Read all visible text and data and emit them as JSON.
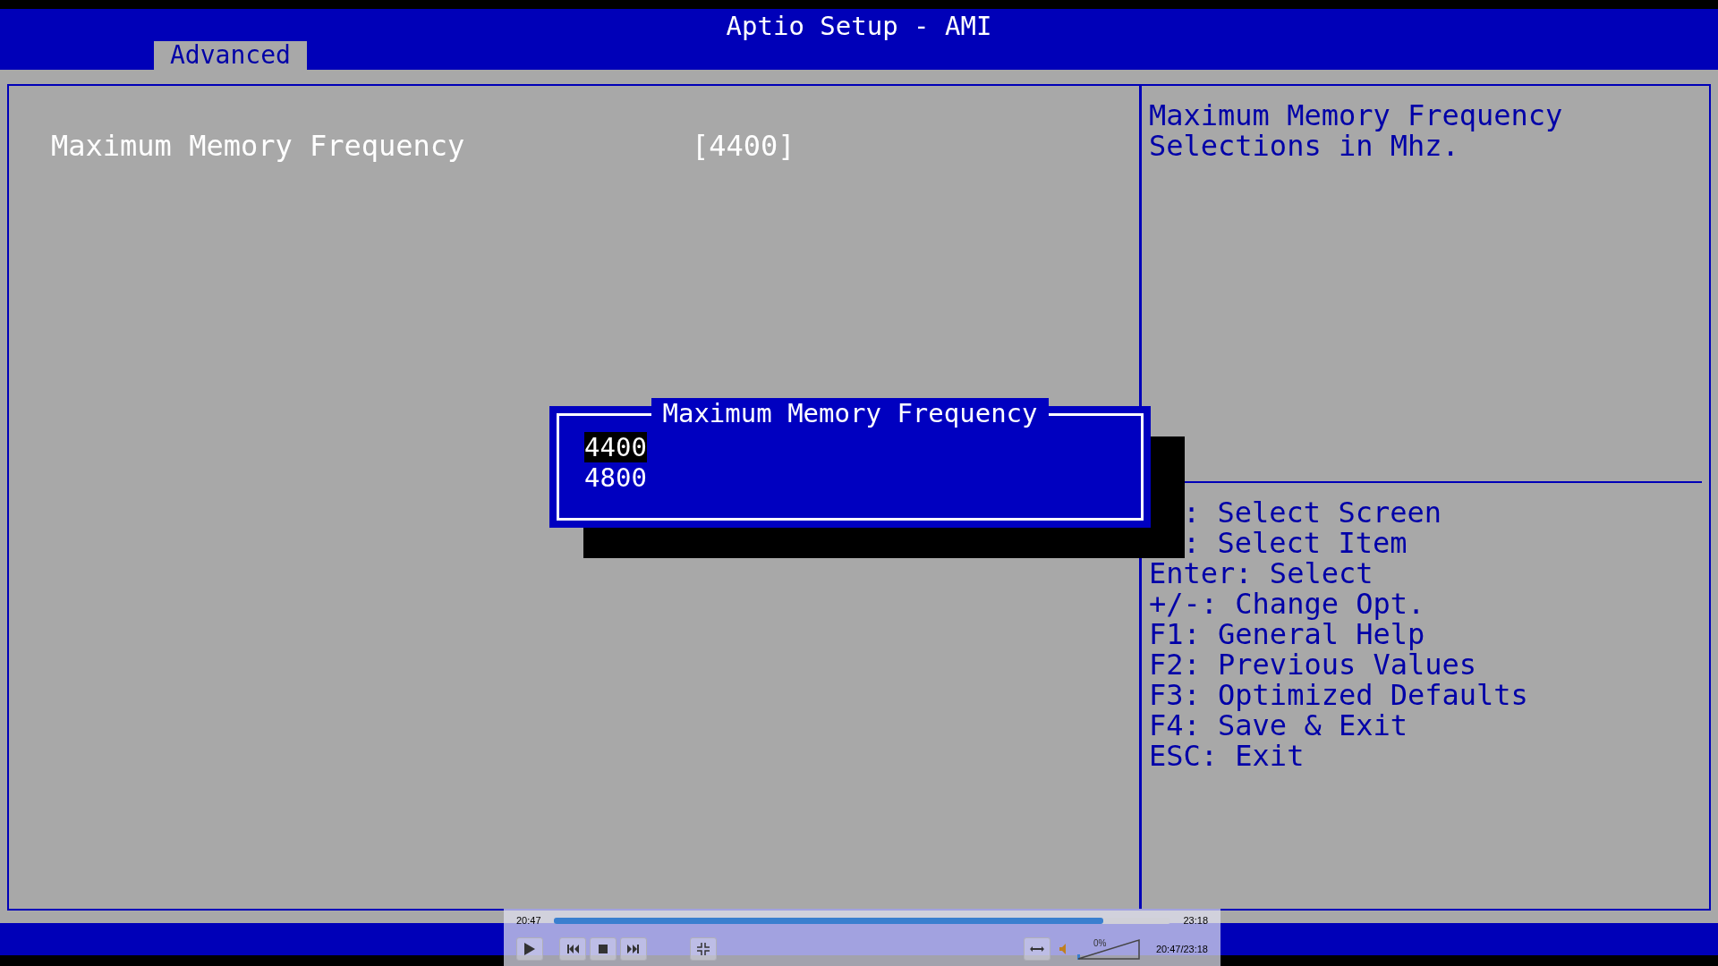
{
  "window": {
    "title": "Aptio Setup - AMI"
  },
  "tabs": [
    {
      "label": "Advanced",
      "selected": true
    }
  ],
  "settings": [
    {
      "label": "Maximum Memory Frequency",
      "value": "[4400]",
      "selected": true
    }
  ],
  "help": {
    "description": "Maximum Memory Frequency Selections in Mhz.",
    "keys": [
      {
        "text": ": Select Screen",
        "indented": true
      },
      {
        "text": ": Select Item",
        "indented": true
      },
      {
        "text": "Enter: Select",
        "indented": false
      },
      {
        "text": "+/-: Change Opt.",
        "indented": false
      },
      {
        "text": "F1: General Help",
        "indented": false
      },
      {
        "text": "F2: Previous Values",
        "indented": false
      },
      {
        "text": "F3: Optimized Defaults",
        "indented": false
      },
      {
        "text": "F4: Save & Exit",
        "indented": false
      },
      {
        "text": "ESC: Exit",
        "indented": false
      }
    ]
  },
  "popup": {
    "title": "Maximum Memory Frequency",
    "options": [
      {
        "label": "4400",
        "selected": true
      },
      {
        "label": "4800",
        "selected": false
      }
    ]
  },
  "player": {
    "elapsed": "20:47",
    "total": "23:18",
    "level": 0.89,
    "time_readout": "20:47/23:18",
    "volume_reading": "0%",
    "volume": {
      "level": 0
    }
  }
}
